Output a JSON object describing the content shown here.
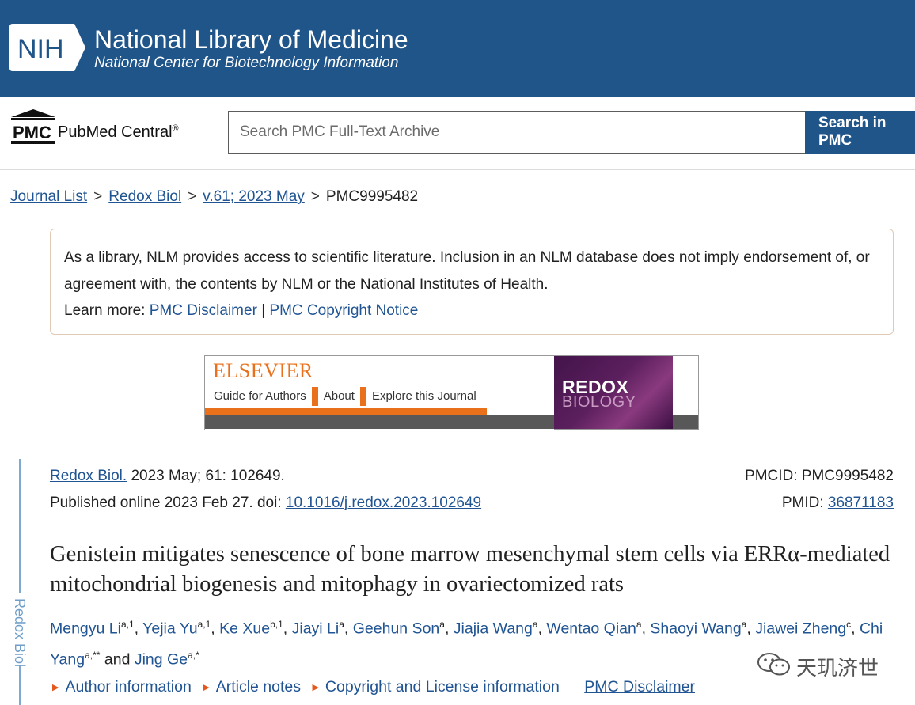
{
  "nih_header": {
    "logo_text": "NIH",
    "title": "National Library of Medicine",
    "subtitle": "National Center for Biotechnology Information"
  },
  "pmc_header": {
    "logo_text": "PMC",
    "name": "PubMed Central",
    "registered": "®",
    "search_placeholder": "Search PMC Full-Text Archive",
    "search_button": "Search in PMC"
  },
  "breadcrumb": {
    "items": [
      "Journal List",
      "Redox Biol",
      "v.61; 2023 May"
    ],
    "separator": ">",
    "current": "PMC9995482"
  },
  "notice": {
    "text": "As a library, NLM provides access to scientific literature. Inclusion in an NLM database does not imply endorsement of, or agreement with, the contents by NLM or the National Institutes of Health.",
    "learn_more": "Learn more:",
    "link_disclaimer": "PMC Disclaimer",
    "separator": "|",
    "link_copyright": "PMC Copyright Notice"
  },
  "banner": {
    "publisher": "ELSEVIER",
    "nav": [
      "Guide for Authors",
      "About",
      "Explore this Journal"
    ],
    "journal_line1": "REDOX",
    "journal_line2": "BIOLOGY",
    "accent_color": "#e9711c"
  },
  "citation": {
    "journal": "Redox Biol.",
    "details": " 2023 May; 61: 102649.",
    "published": "Published online 2023 Feb 27. doi: ",
    "doi": "10.1016/j.redox.2023.102649",
    "pmcid": "PMCID: PMC9995482",
    "pmid_label": "PMID: ",
    "pmid": "36871183"
  },
  "sidebar_label": "Redox Biol",
  "article": {
    "title": "Genistein mitigates senescence of bone marrow mesenchymal stem cells via ERRα-mediated mitochondrial biogenesis and mitophagy in ovariectomized rats",
    "authors": [
      {
        "name": "Mengyu Li",
        "sup": "a,1",
        "sep": ","
      },
      {
        "name": "Yejia Yu",
        "sup": "a,1",
        "sep": ","
      },
      {
        "name": "Ke Xue",
        "sup": "b,1",
        "sep": ","
      },
      {
        "name": "Jiayi Li",
        "sup": "a",
        "sep": ","
      },
      {
        "name": "Geehun Son",
        "sup": "a",
        "sep": ","
      },
      {
        "name": "Jiajia Wang",
        "sup": "a",
        "sep": ","
      },
      {
        "name": "Wentao Qian",
        "sup": "a",
        "sep": ","
      },
      {
        "name": "Shaoyi Wang",
        "sup": "a",
        "sep": ","
      },
      {
        "name": "Jiawei Zheng",
        "sup": "c",
        "sep": ","
      },
      {
        "name": "Chi Yang",
        "sup": "a,**",
        "sep": " and"
      },
      {
        "name": "Jing Ge",
        "sup": "a,*",
        "sep": ""
      }
    ]
  },
  "meta_links": {
    "author_info": "Author information",
    "article_notes": "Article notes",
    "copyright": "Copyright and License information",
    "disclaimer": "PMC Disclaimer"
  },
  "watermark": "天玑济世",
  "colors": {
    "nih_blue": "#20558a",
    "link_blue": "#205493",
    "arrow_orange": "#e3581d"
  }
}
